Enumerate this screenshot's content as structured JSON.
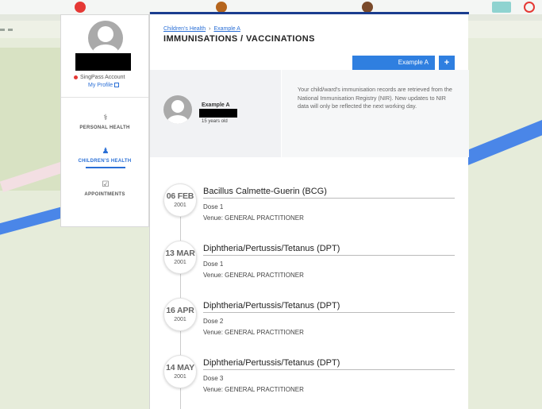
{
  "colors": {
    "accent": "#2f7fe0",
    "header_rule": "#1a3d8f",
    "status_dot": "#e53935",
    "river": "#4a86e8"
  },
  "sidebar": {
    "singpass_label": "SingPass Account",
    "my_profile_label": "My Profile",
    "nav": [
      {
        "label": "PERSONAL HEALTH",
        "icon": "personal-health-icon"
      },
      {
        "label": "CHILDREN'S HEALTH",
        "icon": "children-health-icon",
        "active": true
      },
      {
        "label": "APPOINTMENTS",
        "icon": "calendar-check-icon"
      }
    ]
  },
  "header": {
    "breadcrumb": [
      "Children's Health",
      "Example A"
    ],
    "title": "IMMUNISATIONS / VACCINATIONS",
    "child_selector": "Example A",
    "add_button": "+"
  },
  "child": {
    "name": "Example A",
    "age": "15 years old",
    "notice": "Your child/ward's immunisation records are retrieved from the National Immunisation Registry (NIR). New updates to NIR data will only be reflected the next working day."
  },
  "immunisations": [
    {
      "date": "06 FEB",
      "year": "2001",
      "name": "Bacillus Calmette-Guerin (BCG)",
      "dose": "Dose 1",
      "venue": "Venue: GENERAL PRACTITIONER"
    },
    {
      "date": "13 MAR",
      "year": "2001",
      "name": "Diphtheria/Pertussis/Tetanus (DPT)",
      "dose": "Dose 1",
      "venue": "Venue: GENERAL PRACTITIONER"
    },
    {
      "date": "16 APR",
      "year": "2001",
      "name": "Diphtheria/Pertussis/Tetanus (DPT)",
      "dose": "Dose 2",
      "venue": "Venue: GENERAL PRACTITIONER"
    },
    {
      "date": "14 MAY",
      "year": "2001",
      "name": "Diphtheria/Pertussis/Tetanus (DPT)",
      "dose": "Dose 3",
      "venue": "Venue: GENERAL PRACTITIONER"
    }
  ]
}
